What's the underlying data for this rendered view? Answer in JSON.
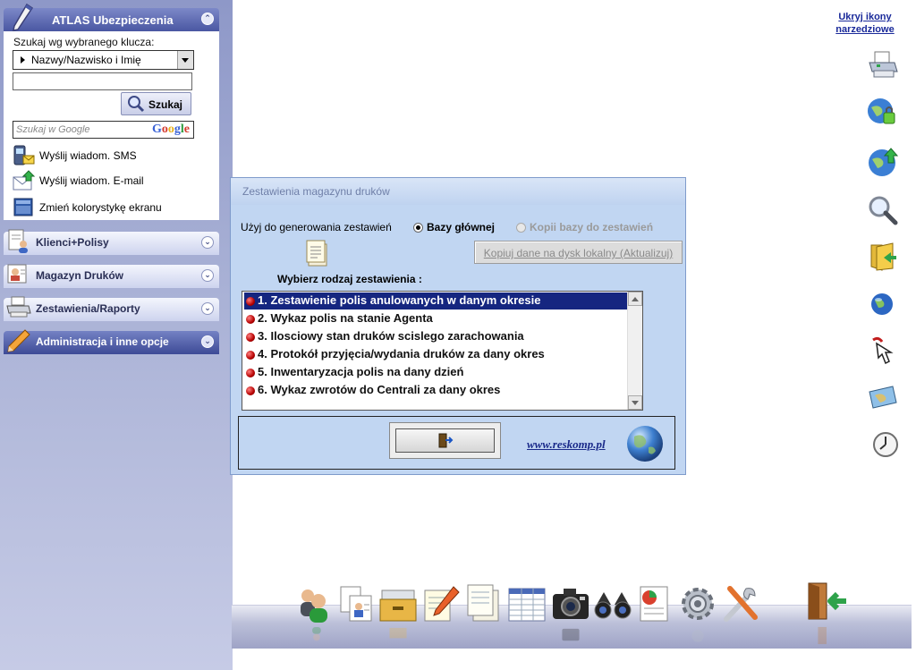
{
  "sidebar": {
    "title": "ATLAS Ubezpieczenia",
    "search_key_label": "Szukaj wg wybranego klucza:",
    "search_key_value": "Nazwy/Nazwisko i Imię",
    "search_input_value": "",
    "search_button": "Szukaj",
    "google_placeholder": "Szukaj w Google",
    "google_logo": "Google",
    "actions": [
      {
        "label": "Wyślij wiadom. SMS",
        "icon": "sms-phone-icon"
      },
      {
        "label": "Wyślij wiadom. E-mail",
        "icon": "email-envelope-icon"
      },
      {
        "label": "Zmień kolorystykę ekranu",
        "icon": "color-scheme-icon"
      }
    ],
    "panels": [
      {
        "label": "Klienci+Polisy",
        "icon": "clients-policies-icon"
      },
      {
        "label": "Magazyn Druków",
        "icon": "print-storage-icon"
      },
      {
        "label": "Zestawienia/Raporty",
        "icon": "printer-reports-icon"
      },
      {
        "label": "Administracja i inne opcje",
        "icon": "admin-pencil-icon"
      }
    ]
  },
  "dialog": {
    "title": "Zestawienia magazynu druków",
    "source_label": "Użyj do generowania zestawień",
    "radio_main": "Bazy głównej",
    "radio_copy": "Kopii bazy do zestawień",
    "copy_button": "Kopiuj dane na dysk lokalny (Aktualizuj)",
    "choose_label": "Wybierz rodzaj zestawienia :",
    "reports": [
      "1. Zestawienie polis anulowanych w danym okresie",
      "2. Wykaz polis na stanie Agenta",
      "3. Ilosciowy stan druków scislego zarachowania",
      "4. Protokół przyjęcia/wydania druków za dany okres",
      "5. Inwentaryzacja polis na dany dzień",
      "6. Wykaz zwrotów do Centrali za dany okres"
    ],
    "selected_index": 0,
    "website": "www.reskomp.pl"
  },
  "toolbar": {
    "hide_link": "Ukryj ikony narzedziowe",
    "icons": [
      "printer-icon",
      "globe-lock-icon",
      "globe-upload-icon",
      "magnifier-icon",
      "folder-back-icon",
      "globe-icon",
      "cursor-hand-icon",
      "map-icon",
      "clock-icon"
    ]
  },
  "dock": {
    "icons": [
      "users-icon",
      "client-cards-icon",
      "archive-drawer-icon",
      "notepad-pencil-icon",
      "documents-icon",
      "table-icon",
      "camera-icon",
      "binoculars-icon",
      "report-chart-icon",
      "settings-gear-icon",
      "tools-icon",
      "exit-door-icon"
    ]
  },
  "colors": {
    "sidebar_bg": "#aab2d6",
    "dialog_bg": "#c1d6f2",
    "selection": "#152680",
    "link": "#1a2a9a"
  }
}
